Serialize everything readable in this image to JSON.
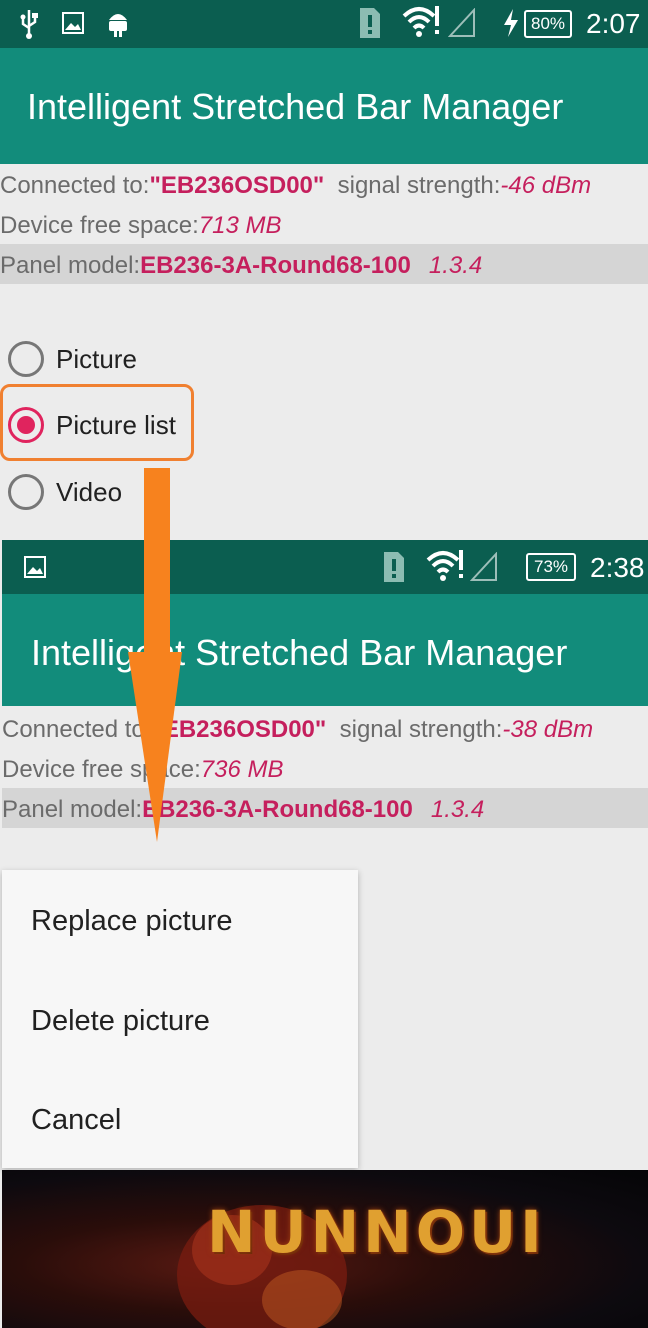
{
  "screen1": {
    "status": {
      "battery": "80%",
      "time": "2:07"
    },
    "app_title": "Intelligent Stretched Bar Manager",
    "connected_label": "Connected to:",
    "connected_device": "\"EB236OSD00\"",
    "signal_label": "signal strength:",
    "signal_value": "-46 dBm",
    "free_label": "Device free space:",
    "free_value": "713 MB",
    "panel_label": "Panel model:",
    "panel_value": "EB236-3A-Round68-100",
    "version": "1.3.4",
    "radio_options": [
      {
        "label": "Picture",
        "checked": false
      },
      {
        "label": "Picture list",
        "checked": true
      },
      {
        "label": "Video",
        "checked": false
      }
    ]
  },
  "screen2": {
    "status": {
      "battery": "73%",
      "time": "2:38"
    },
    "app_title": "Intelligent Stretched Bar Manager",
    "connected_label": "Connected to:",
    "connected_device": "\"EB236OSD00\"",
    "signal_label": "signal strength:",
    "signal_value": "-38 dBm",
    "free_label": "Device free space:",
    "free_value": "736 MB",
    "panel_label": "Panel model:",
    "panel_value": "EB236-3A-Round68-100",
    "version": "1.3.4",
    "menu": {
      "replace": "Replace picture",
      "delete": "Delete picture",
      "cancel": "Cancel"
    },
    "image_brand": "NUNNOUI"
  },
  "colors": {
    "accent_pink": "#c51f5d",
    "appbar": "#128c7b",
    "statusbar": "#0b5e50",
    "arrow": "#f7821e"
  }
}
